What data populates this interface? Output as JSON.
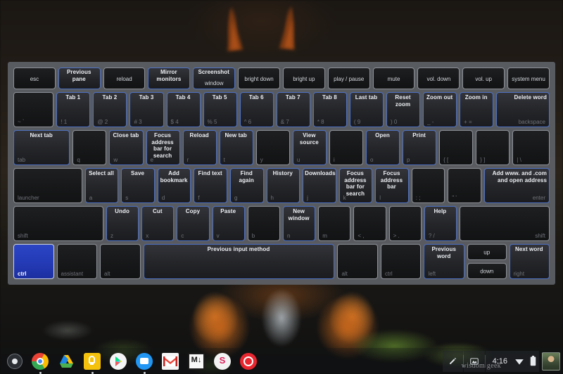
{
  "wallpaper": {
    "description": "squirrel-on-mossy-ground-dark-photo"
  },
  "overlay": {
    "title": "keyboard-shortcut-overlay",
    "selected_key": "ctrl",
    "accent_color": "#4f72c4",
    "selected_color": "#2339b4",
    "panel_color": "#5c6065"
  },
  "rows": {
    "function_row": [
      {
        "top": "",
        "bottom": "esc",
        "hl": false,
        "flex": 1.55
      },
      {
        "top": "Previous pane",
        "bottom": "",
        "hl": true,
        "flex": 1.55
      },
      {
        "top": "",
        "bottom": "reload",
        "hl": false,
        "flex": 1.55
      },
      {
        "top": "Mirror monitors",
        "bottom": "",
        "hl": true,
        "flex": 1.55
      },
      {
        "top": "Screenshot",
        "bottom": "window",
        "hl": true,
        "flex": 1.55
      },
      {
        "top": "",
        "bottom": "bright down",
        "hl": false,
        "flex": 1.55
      },
      {
        "top": "",
        "bottom": "bright up",
        "hl": false,
        "flex": 1.55
      },
      {
        "top": "",
        "bottom": "play / pause",
        "hl": false,
        "flex": 1.55
      },
      {
        "top": "",
        "bottom": "mute",
        "hl": false,
        "flex": 1.55
      },
      {
        "top": "",
        "bottom": "vol. down",
        "hl": false,
        "flex": 1.55
      },
      {
        "top": "",
        "bottom": "vol. up",
        "hl": false,
        "flex": 1.55
      },
      {
        "top": "",
        "bottom": "system menu",
        "hl": false,
        "flex": 1.55
      }
    ],
    "number_row": [
      {
        "top": "",
        "bottom": "~ `",
        "hl": false,
        "flex": 1.2
      },
      {
        "top": "Tab 1",
        "bottom": "! 1",
        "hl": true,
        "flex": 1
      },
      {
        "top": "Tab 2",
        "bottom": "@ 2",
        "hl": true,
        "flex": 1
      },
      {
        "top": "Tab 3",
        "bottom": "# 3",
        "hl": true,
        "flex": 1
      },
      {
        "top": "Tab 4",
        "bottom": "$ 4",
        "hl": true,
        "flex": 1
      },
      {
        "top": "Tab 5",
        "bottom": "% 5",
        "hl": true,
        "flex": 1
      },
      {
        "top": "Tab 6",
        "bottom": "^ 6",
        "hl": true,
        "flex": 1
      },
      {
        "top": "Tab 7",
        "bottom": "& 7",
        "hl": true,
        "flex": 1
      },
      {
        "top": "Tab 8",
        "bottom": "* 8",
        "hl": true,
        "flex": 1
      },
      {
        "top": "Last tab",
        "bottom": "( 9",
        "hl": true,
        "flex": 1
      },
      {
        "top": "Reset zoom",
        "bottom": ") 0",
        "hl": true,
        "flex": 1
      },
      {
        "top": "Zoom out",
        "bottom": "_ -",
        "hl": true,
        "flex": 1
      },
      {
        "top": "Zoom in",
        "bottom": "+ =",
        "hl": true,
        "flex": 1
      },
      {
        "top": "Delete word",
        "bottom": "backspace",
        "hl": true,
        "flex": 1.6,
        "align": "right"
      }
    ],
    "q_row": [
      {
        "top": "Next tab",
        "bottom": "tab",
        "hl": true,
        "flex": 1.7
      },
      {
        "top": "",
        "bottom": "q",
        "hl": false,
        "flex": 1
      },
      {
        "top": "Close tab",
        "bottom": "w",
        "hl": true,
        "flex": 1
      },
      {
        "top": "Focus address bar for search",
        "bottom": "e",
        "hl": true,
        "flex": 1
      },
      {
        "top": "Reload",
        "bottom": "r",
        "hl": true,
        "flex": 1
      },
      {
        "top": "New tab",
        "bottom": "t",
        "hl": true,
        "flex": 1
      },
      {
        "top": "",
        "bottom": "y",
        "hl": false,
        "flex": 1
      },
      {
        "top": "View source",
        "bottom": "u",
        "hl": true,
        "flex": 1
      },
      {
        "top": "",
        "bottom": "i",
        "hl": false,
        "flex": 1
      },
      {
        "top": "Open",
        "bottom": "o",
        "hl": true,
        "flex": 1
      },
      {
        "top": "Print",
        "bottom": "p",
        "hl": true,
        "flex": 1
      },
      {
        "top": "",
        "bottom": "{ [",
        "hl": false,
        "flex": 1
      },
      {
        "top": "",
        "bottom": "} ]",
        "hl": false,
        "flex": 1
      },
      {
        "top": "",
        "bottom": "| \\",
        "hl": false,
        "flex": 1.1
      }
    ],
    "a_row": [
      {
        "top": "",
        "bottom": "launcher",
        "hl": false,
        "flex": 2.1
      },
      {
        "top": "Select all",
        "bottom": "a",
        "hl": true,
        "flex": 1
      },
      {
        "top": "Save",
        "bottom": "s",
        "hl": true,
        "flex": 1
      },
      {
        "top": "Add bookmark",
        "bottom": "d",
        "hl": true,
        "flex": 1
      },
      {
        "top": "Find text",
        "bottom": "f",
        "hl": true,
        "flex": 1
      },
      {
        "top": "Find again",
        "bottom": "g",
        "hl": true,
        "flex": 1
      },
      {
        "top": "History",
        "bottom": "h",
        "hl": true,
        "flex": 1
      },
      {
        "top": "Downloads",
        "bottom": "j",
        "hl": true,
        "flex": 1
      },
      {
        "top": "Focus address bar for search",
        "bottom": "k",
        "hl": true,
        "flex": 1
      },
      {
        "top": "Focus address bar",
        "bottom": "l",
        "hl": true,
        "flex": 1
      },
      {
        "top": "",
        "bottom": ": ;",
        "hl": false,
        "flex": 1
      },
      {
        "top": "",
        "bottom": "\" '",
        "hl": false,
        "flex": 1
      },
      {
        "top": "Add www. and .com and open address",
        "bottom": "enter",
        "hl": true,
        "flex": 2.0,
        "align": "right"
      }
    ],
    "z_row": [
      {
        "top": "",
        "bottom": "shift",
        "hl": false,
        "flex": 2.85
      },
      {
        "top": "Undo",
        "bottom": "z",
        "hl": true,
        "flex": 1
      },
      {
        "top": "Cut",
        "bottom": "x",
        "hl": true,
        "flex": 1
      },
      {
        "top": "Copy",
        "bottom": "c",
        "hl": true,
        "flex": 1
      },
      {
        "top": "Paste",
        "bottom": "v",
        "hl": true,
        "flex": 1
      },
      {
        "top": "",
        "bottom": "b",
        "hl": false,
        "flex": 1
      },
      {
        "top": "New window",
        "bottom": "n",
        "hl": true,
        "flex": 1
      },
      {
        "top": "",
        "bottom": "m",
        "hl": false,
        "flex": 1
      },
      {
        "top": "",
        "bottom": "< ,",
        "hl": false,
        "flex": 1
      },
      {
        "top": "",
        "bottom": "> .",
        "hl": false,
        "flex": 1
      },
      {
        "top": "Help",
        "bottom": "? /",
        "hl": true,
        "flex": 1
      },
      {
        "top": "",
        "bottom": "shift",
        "hl": false,
        "flex": 2.85,
        "align": "right"
      }
    ],
    "ctrl_row": [
      {
        "top": "",
        "bottom": "ctrl",
        "hl": false,
        "flex": 1.45,
        "selected": true
      },
      {
        "top": "",
        "bottom": "assistant",
        "hl": false,
        "flex": 1.45
      },
      {
        "top": "",
        "bottom": "alt",
        "hl": false,
        "flex": 1.45
      },
      {
        "top": "Previous input method",
        "bottom": "",
        "hl": true,
        "flex": 7.05
      },
      {
        "top": "",
        "bottom": "alt",
        "hl": false,
        "flex": 1.45
      },
      {
        "top": "",
        "bottom": "ctrl",
        "hl": false,
        "flex": 1.45
      },
      {
        "top": "Previous word",
        "bottom": "left",
        "hl": true,
        "flex": 1.45
      }
    ],
    "arrow_stack": [
      {
        "top": "",
        "bottom": "up",
        "hl": false
      },
      {
        "top": "",
        "bottom": "down",
        "hl": false
      }
    ],
    "arrow_right": {
      "top": "Next word",
      "bottom": "right",
      "hl": true,
      "flex": 1.45
    }
  },
  "shelf": {
    "launcher_label": "launcher-button",
    "apps": [
      {
        "name": "chrome-icon",
        "running": true
      },
      {
        "name": "google-drive-icon",
        "running": false
      },
      {
        "name": "google-keep-icon",
        "running": true
      },
      {
        "name": "play-store-icon",
        "running": false
      },
      {
        "name": "google-photos-icon",
        "running": true
      },
      {
        "name": "gmail-icon",
        "running": false
      },
      {
        "name": "markdown-icon",
        "running": false
      },
      {
        "name": "slack-icon",
        "running": false
      },
      {
        "name": "opera-icon",
        "running": false
      }
    ],
    "status": {
      "stylus_icon": "pen-icon",
      "capture_icon": "screen-capture-icon",
      "clock": "4:16",
      "wifi_icon": "wifi-icon",
      "battery_icon": "battery-icon",
      "avatar": "user-avatar"
    },
    "watermark": "wisdom geek"
  }
}
